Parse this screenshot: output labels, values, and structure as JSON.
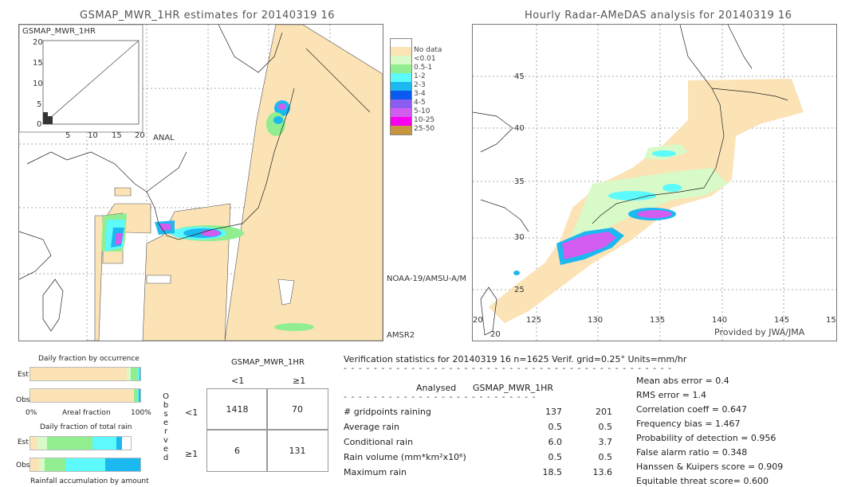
{
  "left_panel": {
    "title": "GSMAP_MWR_1HR estimates for 20140319 16",
    "scatter": {
      "ylabel": "GSMAP_MWR_1HR",
      "xlabel": "ANAL",
      "y_ticks": [
        "20",
        "15",
        "10",
        "5",
        "0"
      ],
      "x_ticks": [
        "5",
        "10",
        "15",
        "20"
      ]
    },
    "sensor_labels": [
      "NOAA-19/AMSU-A/M",
      "AMSR2"
    ]
  },
  "legend": {
    "items": [
      {
        "label": "",
        "color": "#ffffff"
      },
      {
        "label": "No data",
        "color": "#fbe3b6"
      },
      {
        "label": "<0.01",
        "color": "#d8fac8"
      },
      {
        "label": "0.5-1",
        "color": "#90ee90"
      },
      {
        "label": "1-2",
        "color": "#5cfafa"
      },
      {
        "label": "2-3",
        "color": "#1cb8f0"
      },
      {
        "label": "3-4",
        "color": "#0a5af0"
      },
      {
        "label": "4-5",
        "color": "#8c5cf0"
      },
      {
        "label": "5-10",
        "color": "#d25cf0"
      },
      {
        "label": "10-25",
        "color": "#f800f0"
      },
      {
        "label": "25-50",
        "color": "#c89640"
      }
    ]
  },
  "right_panel": {
    "title": "Hourly Radar-AMeDAS analysis for 20140319 16",
    "lat_ticks": [
      "45",
      "40",
      "35",
      "30",
      "25",
      "20"
    ],
    "lon_ticks": [
      "125",
      "130",
      "135",
      "140",
      "145",
      "15"
    ],
    "corner_labels": [
      "20",
      "20"
    ],
    "credit": "Provided by JWA/JMA"
  },
  "occurrence": {
    "title": "Daily fraction by occurrence",
    "est_label": "Est",
    "obs_label": "Obs",
    "axis_left": "0%",
    "axis_mid": "Areal fraction",
    "axis_right": "100%",
    "est_segments": [
      {
        "fraction": 0.875,
        "color": "#fbe3b6"
      },
      {
        "fraction": 0.035,
        "color": "#d8fac8"
      },
      {
        "fraction": 0.07,
        "color": "#90ee90"
      },
      {
        "fraction": 0.013,
        "color": "#5cfafa"
      },
      {
        "fraction": 0.007,
        "color": "#1cb8f0"
      }
    ],
    "obs_segments": [
      {
        "fraction": 0.935,
        "color": "#fbe3b6"
      },
      {
        "fraction": 0.01,
        "color": "#d8fac8"
      },
      {
        "fraction": 0.025,
        "color": "#90ee90"
      },
      {
        "fraction": 0.018,
        "color": "#5cfafa"
      },
      {
        "fraction": 0.012,
        "color": "#1cb8f0"
      }
    ]
  },
  "total_rain": {
    "title": "Daily fraction of total rain",
    "est_label": "Est",
    "obs_label": "Obs",
    "footer": "Rainfall accumulation by amount",
    "est_segments": [
      {
        "fraction": 0.07,
        "color": "#fbe3b6"
      },
      {
        "fraction": 0.1,
        "color": "#d8fac8"
      },
      {
        "fraction": 0.45,
        "color": "#90ee90"
      },
      {
        "fraction": 0.24,
        "color": "#5cfafa"
      },
      {
        "fraction": 0.05,
        "color": "#1cb8f0"
      }
    ],
    "obs_segments": [
      {
        "fraction": 0.08,
        "color": "#fbe3b6"
      },
      {
        "fraction": 0.05,
        "color": "#d8fac8"
      },
      {
        "fraction": 0.19,
        "color": "#90ee90"
      },
      {
        "fraction": 0.36,
        "color": "#5cfafa"
      },
      {
        "fraction": 0.32,
        "color": "#1cb8f0"
      }
    ]
  },
  "contingency": {
    "est_header": "GSMAP_MWR_1HR",
    "col_labels": [
      "<1",
      "≥1"
    ],
    "row_labels": [
      "<1",
      "≥1"
    ],
    "obs_header": "Observed",
    "cells": [
      [
        "1418",
        "70"
      ],
      [
        "6",
        "131"
      ]
    ]
  },
  "verification": {
    "header": "Verification statistics for 20140319 16   n=1625   Verif. grid=0.25°   Units=mm/hr",
    "col_analysed": "Analysed",
    "col_est": "GSMAP_MWR_1HR",
    "rows": [
      {
        "label": "# gridpoints raining",
        "analysed": "137",
        "est": "201"
      },
      {
        "label": "Average rain",
        "analysed": "0.5",
        "est": "0.5"
      },
      {
        "label": "Conditional rain",
        "analysed": "6.0",
        "est": "3.7"
      },
      {
        "label": "Rain volume (mm*km²x10⁶)",
        "analysed": "0.5",
        "est": "0.5"
      },
      {
        "label": "Maximum rain",
        "analysed": "18.5",
        "est": "13.6"
      }
    ],
    "scores": [
      "Mean abs error = 0.4",
      "RMS error = 1.4",
      "Correlation coeff = 0.647",
      "Frequency bias = 1.467",
      "Probability of detection = 0.956",
      "False alarm ratio = 0.348",
      "Hanssen & Kuipers score = 0.909",
      "Equitable threat score= 0.600"
    ]
  }
}
